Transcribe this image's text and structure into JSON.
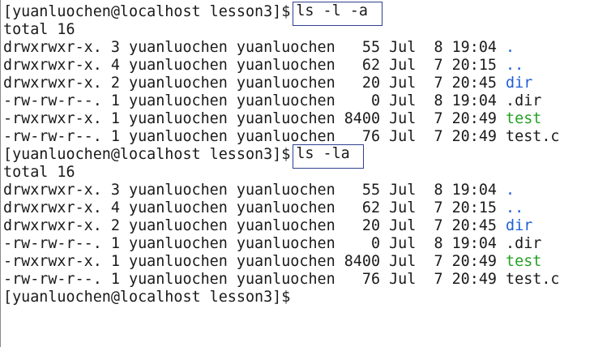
{
  "terminal": {
    "blocks": [
      {
        "prompt": "[yuanluochen@localhost lesson3]$",
        "command": "ls -l -a",
        "total": "total 16",
        "entries": [
          {
            "meta": "drwxrwxr-x. 3 yuanluochen yuanluochen   55 Jul  8 19:04 ",
            "name": ".",
            "color": "#1f5fd6"
          },
          {
            "meta": "drwxrwxr-x. 4 yuanluochen yuanluochen   62 Jul  7 20:15 ",
            "name": "..",
            "color": "#1f5fd6"
          },
          {
            "meta": "drwxrwxr-x. 2 yuanluochen yuanluochen   20 Jul  7 20:45 ",
            "name": "dir",
            "color": "#1f5fd6"
          },
          {
            "meta": "-rw-rw-r--. 1 yuanluochen yuanluochen    0 Jul  8 19:04 ",
            "name": ".dir",
            "color": "#1a1a1a"
          },
          {
            "meta": "-rwxrwxr-x. 1 yuanluochen yuanluochen 8400 Jul  7 20:49 ",
            "name": "test",
            "color": "#23a023"
          },
          {
            "meta": "-rw-rw-r--. 1 yuanluochen yuanluochen   76 Jul  7 20:49 ",
            "name": "test.c",
            "color": "#1a1a1a"
          }
        ]
      },
      {
        "prompt": "[yuanluochen@localhost lesson3]$",
        "command": "ls -la",
        "total": "total 16",
        "entries": [
          {
            "meta": "drwxrwxr-x. 3 yuanluochen yuanluochen   55 Jul  8 19:04 ",
            "name": ".",
            "color": "#1f5fd6"
          },
          {
            "meta": "drwxrwxr-x. 4 yuanluochen yuanluochen   62 Jul  7 20:15 ",
            "name": "..",
            "color": "#1f5fd6"
          },
          {
            "meta": "drwxrwxr-x. 2 yuanluochen yuanluochen   20 Jul  7 20:45 ",
            "name": "dir",
            "color": "#1f5fd6"
          },
          {
            "meta": "-rw-rw-r--. 1 yuanluochen yuanluochen    0 Jul  8 19:04 ",
            "name": ".dir",
            "color": "#1a1a1a"
          },
          {
            "meta": "-rwxrwxr-x. 1 yuanluochen yuanluochen 8400 Jul  7 20:49 ",
            "name": "test",
            "color": "#23a023"
          },
          {
            "meta": "-rw-rw-r--. 1 yuanluochen yuanluochen   76 Jul  7 20:49 ",
            "name": "test.c",
            "color": "#1a1a1a"
          }
        ]
      }
    ],
    "final_prompt": "[yuanluochen@localhost lesson3]$"
  }
}
